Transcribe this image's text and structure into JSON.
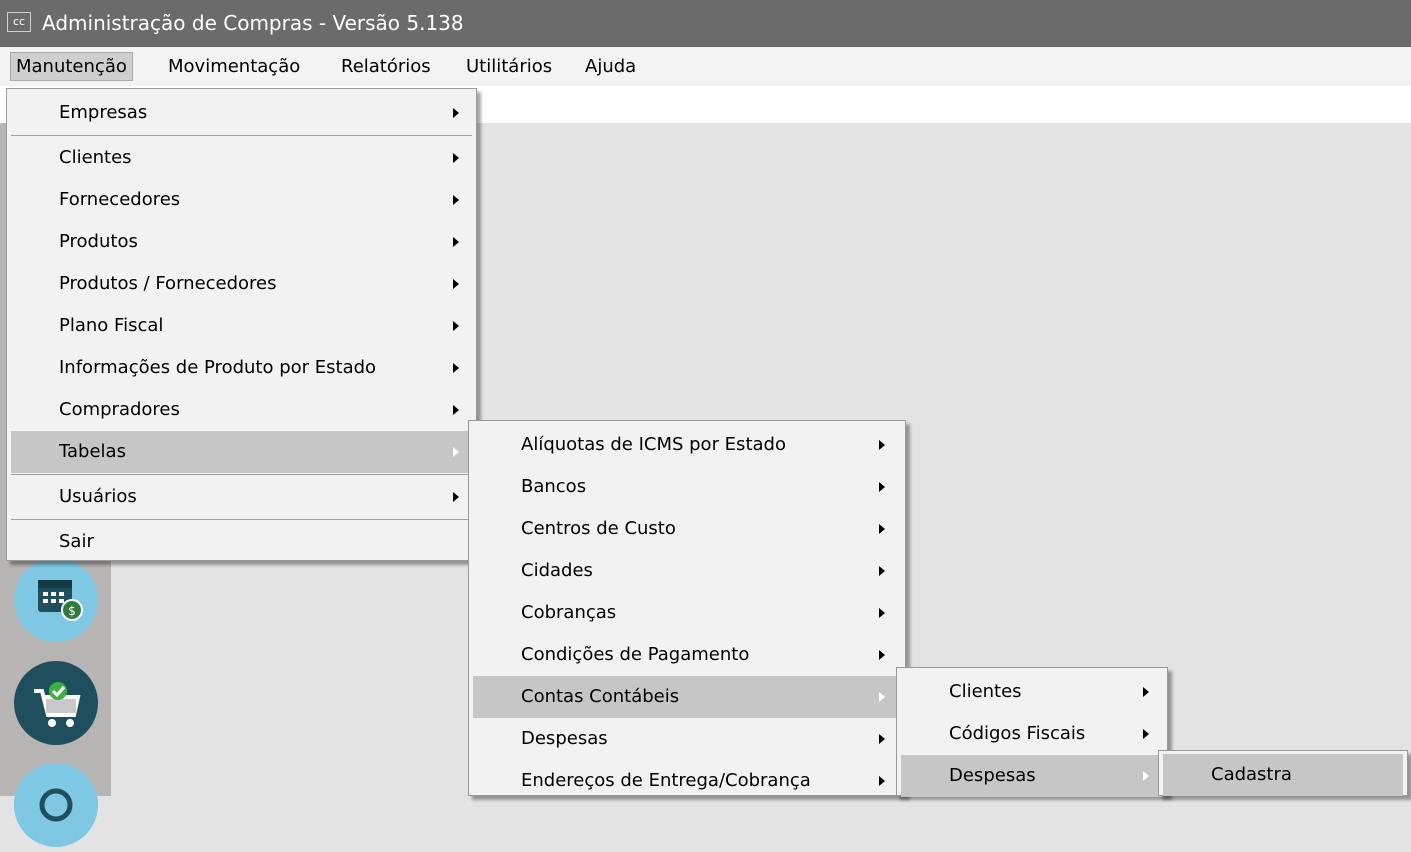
{
  "window": {
    "title": "Administração de Compras - Versão 5.138",
    "icon": "app-icon",
    "icon_text": "cc"
  },
  "menubar": [
    "Manutenção",
    "Movimentação",
    "Relatórios",
    "Utilitários",
    "Ajuda"
  ],
  "manutencao_menu": [
    "Empresas",
    "Clientes",
    "Fornecedores",
    "Produtos",
    "Produtos / Fornecedores",
    "Plano Fiscal",
    "Informações de Produto por Estado",
    "Compradores",
    "Tabelas",
    "Usuários",
    "Sair"
  ],
  "tabelas_menu": [
    "Alíquotas de ICMS por Estado",
    "Bancos",
    "Centros de Custo",
    "Cidades",
    "Cobranças",
    "Condições de Pagamento",
    "Contas Contábeis",
    "Despesas",
    "Endereços de Entrega/Cobrança"
  ],
  "contas_menu": [
    "Clientes",
    "Códigos Fiscais",
    "Despesas"
  ],
  "despesas_menu": [
    "Cadastra"
  ],
  "sidebar_icons": [
    "calendar-money-icon",
    "cart-check-icon",
    "refresh-icon"
  ],
  "colors": {
    "titlebar": "#6b6b6b",
    "menu_bg": "#f2f2f2",
    "highlight": "#c6c6c6",
    "sidebar": "#b7b4b4",
    "icon_circle": "#7ec8e3",
    "icon_dark": "#1f4e5c"
  }
}
